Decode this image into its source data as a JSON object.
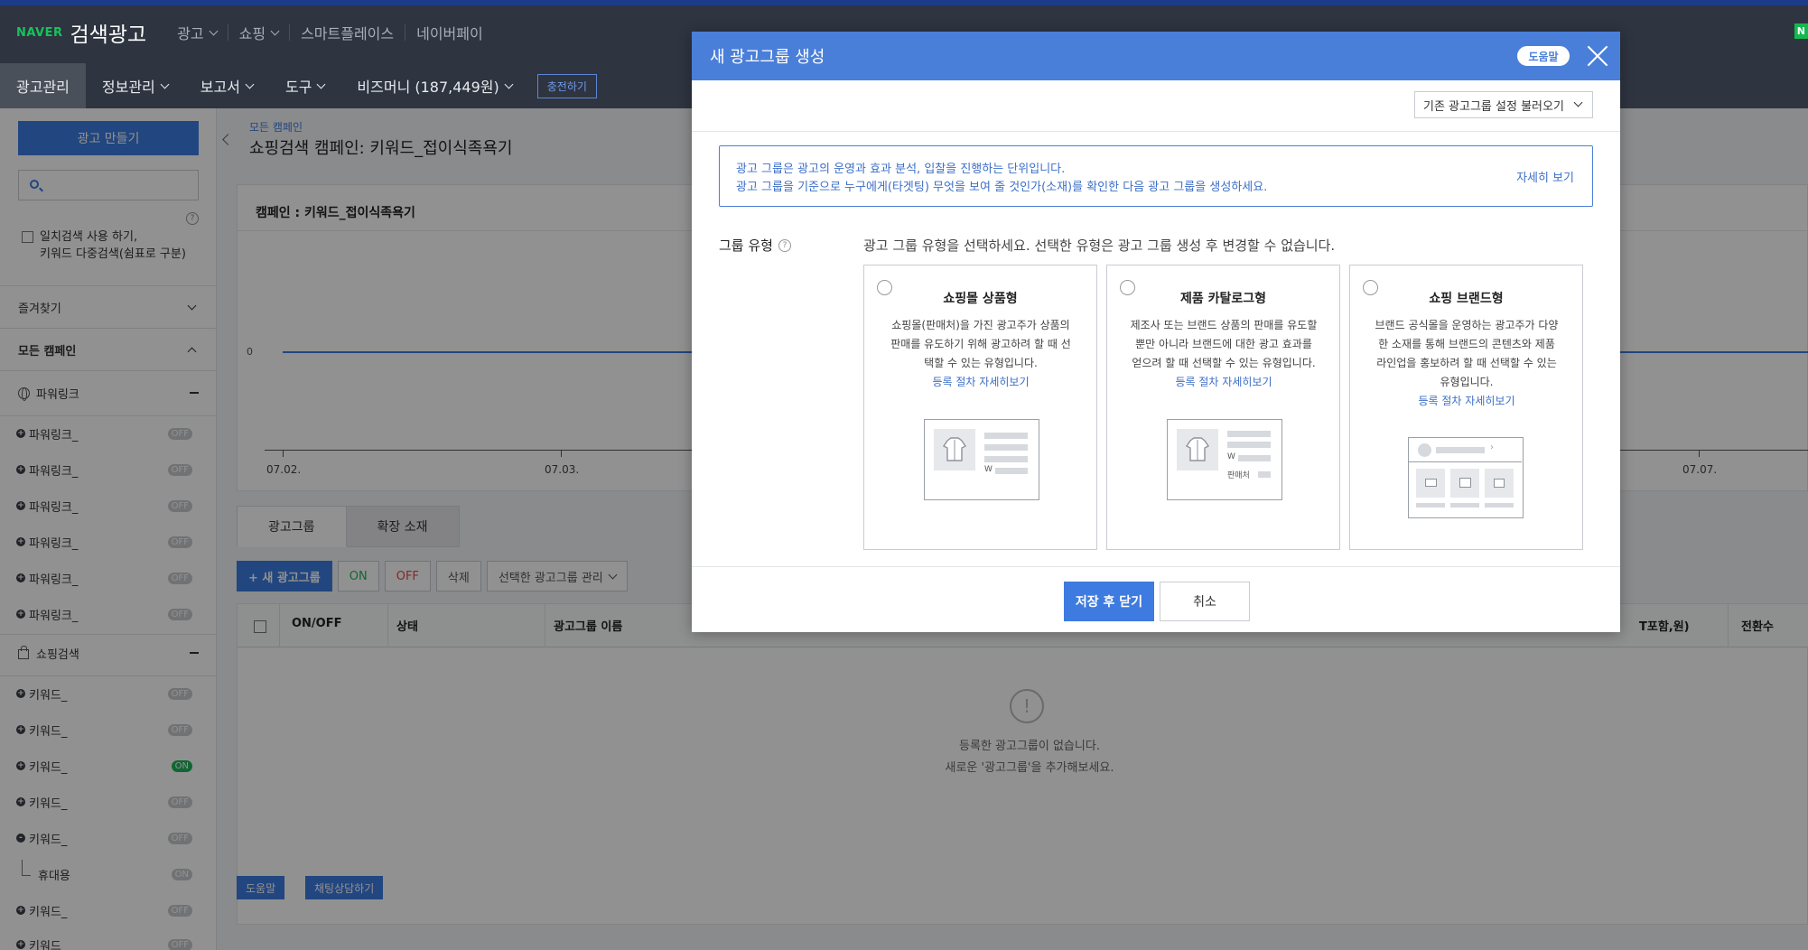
{
  "header": {
    "logo_naver": "NAVER",
    "logo_title": "검색광고",
    "nav": [
      "광고",
      "쇼핑",
      "스마트플레이스",
      "네이버페이"
    ],
    "menu": [
      "광고관리",
      "정보관리",
      "보고서",
      "도구",
      "비즈머니 (187,449원)"
    ],
    "charge_label": "충전하기",
    "corner_badge": "N"
  },
  "sidebar": {
    "make_ad_label": "광고 만들기",
    "exact_line1": "일치검색 사용 하기,",
    "exact_line2": "키워드 다중검색(쉼표로 구분)",
    "favorites": "즐겨찾기",
    "all_campaigns": "모든 캠페인",
    "cat_powerlink": "파워링크",
    "cat_shopping": "쇼핑검색",
    "powerlink_items": [
      {
        "label": "파워링크_",
        "status": "OFF"
      },
      {
        "label": "파워링크_",
        "status": "OFF"
      },
      {
        "label": "파워링크_",
        "status": "OFF"
      },
      {
        "label": "파워링크_",
        "status": "OFF"
      },
      {
        "label": "파워링크_",
        "status": "OFF"
      },
      {
        "label": "파워링크_",
        "status": "OFF"
      }
    ],
    "shopping_items": [
      {
        "label": "키워드_",
        "status": "OFF"
      },
      {
        "label": "키워드_",
        "status": "OFF"
      },
      {
        "label": "키워드_",
        "status": "ON"
      },
      {
        "label": "키워드_",
        "status": "OFF"
      },
      {
        "label": "키워드_",
        "status": "OFF"
      },
      {
        "label": "휴대용",
        "status": "ON"
      },
      {
        "label": "키워드_",
        "status": "OFF"
      },
      {
        "label": "키워드_",
        "status": "OFF"
      }
    ]
  },
  "main": {
    "breadcrumb": "모든 캠페인",
    "title": "쇼핑검색 캠페인: 키워드_접이식족욕기",
    "chart_title": "캠페인 : 키워드_접이식족욕기",
    "y_zero": "0",
    "x_labels": [
      "07.02.",
      "07.03.",
      "07.07."
    ],
    "tabs": [
      "광고그룹",
      "확장 소재"
    ],
    "new_group": "+ 새 광고그룹",
    "on": "ON",
    "off": "OFF",
    "delete": "삭제",
    "manage": "선택한 광고그룹 관리",
    "columns": [
      "ON/OFF",
      "상태",
      "광고그룹 이름",
      "T포함,원)",
      "전환수"
    ],
    "empty1": "등록한 광고그룹이 없습니다.",
    "empty2": "새로운 '광고그룹'을 추가해보세요.",
    "help": "도움말",
    "chat": "채팅상담하기"
  },
  "modal": {
    "title": "새 광고그룹 생성",
    "help": "도움말",
    "load_settings": "기존 광고그룹 설정 불러오기",
    "info_line1": "광고 그룹은 광고의 운영과 효과 분석, 입찰을 진행하는 단위입니다.",
    "info_line2": "광고 그룹을 기준으로 누구에게(타겟팅) 무엇을 보여 줄 것인가(소재)를 확인한 다음 광고 그룹을 생성하세요.",
    "info_more": "자세히 보기",
    "group_type_label": "그룹 유형",
    "group_type_desc": "광고 그룹 유형을 선택하세요. 선택한 유형은 광고 그룹 생성 후 변경할 수 없습니다.",
    "cards": [
      {
        "title": "쇼핑몰 상품형",
        "desc": "쇼핑몰(판매처)을 가진 광고주가 상품의 판매를 유도하기 위해 광고하려 할 때 선택할 수 있는 유형입니다.",
        "link": "등록 절차 자세히보기"
      },
      {
        "title": "제품 카탈로그형",
        "desc": "제조사 또는 브랜드 상품의 판매를 유도할 뿐만 아니라 브랜드에 대한 광고 효과를 얻으려 할 때 선택할 수 있는 유형입니다.",
        "link": "등록 절차 자세히보기"
      },
      {
        "title": "쇼핑 브랜드형",
        "desc": "브랜드 공식몰을 운영하는 광고주가 다양한 소재를 통해 브랜드의 콘텐츠와 제품 라인업을 홍보하려 할 때 선택할 수 있는 유형입니다.",
        "link": "등록 절차 자세히보기"
      }
    ],
    "ill_price": "W",
    "ill_seller": "판매처",
    "save_close": "저장 후 닫기",
    "cancel": "취소"
  }
}
